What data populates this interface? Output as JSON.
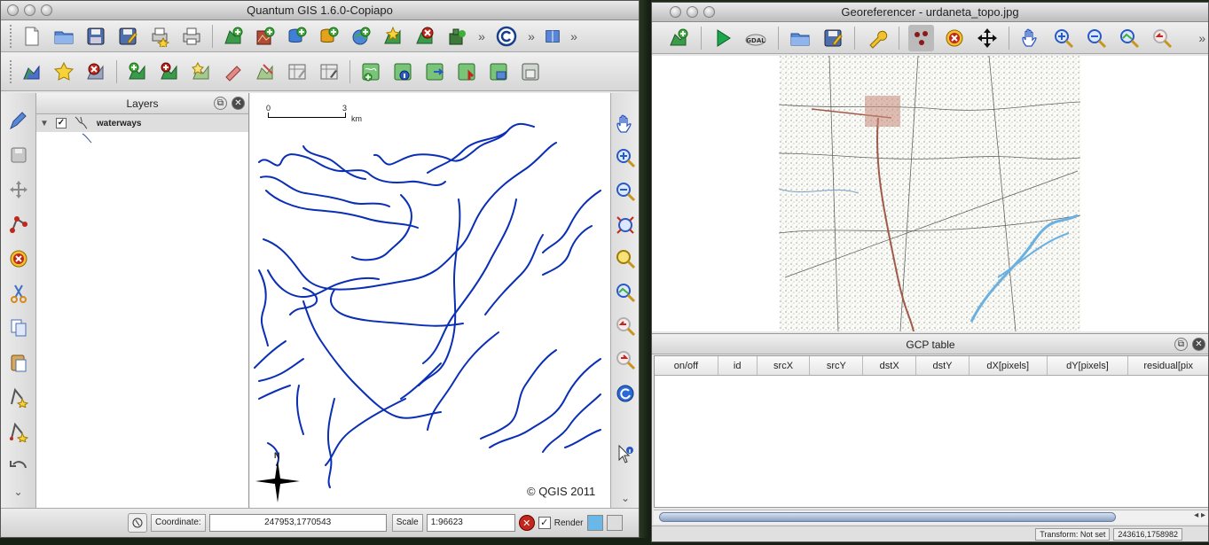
{
  "qgis": {
    "title": "Quantum GIS 1.6.0-Copiapo",
    "toolbar1_icons": [
      "new-project-icon",
      "open-project-icon",
      "save-project-icon",
      "save-as-icon",
      "print-composer-icon",
      "print-icon",
      "add-vector-layer-icon",
      "add-raster-layer-icon",
      "add-postgis-layer-icon",
      "add-spatialite-layer-icon",
      "add-wms-layer-icon",
      "new-vector-layer-icon",
      "remove-layer-icon",
      "plugin-icon",
      "copyright-icon",
      "help-icon"
    ],
    "toolbar2_icons": [
      "toggle-editing-icon",
      "capture-point-icon",
      "delete-selected-icon",
      "add-to-overview-icon",
      "show-all-layers-icon",
      "hide-all-layers-icon",
      "mapcomposer-icon",
      "vertex-tool-icon",
      "open-table-icon",
      "identify-icon",
      "measure-icon",
      "layer-properties-icon",
      "new-bookmark-icon",
      "show-bookmarks-icon",
      "map-tips-icon"
    ],
    "layers_panel": {
      "title": "Layers",
      "layers": [
        {
          "name": "waterways",
          "checked": true
        }
      ]
    },
    "map": {
      "scalebar_start": "0",
      "scalebar_end": "3",
      "scalebar_unit": "km",
      "north_label": "N",
      "copyright": "© QGIS 2011",
      "line_color": "#0a2fb5"
    },
    "status": {
      "coordinate_label": "Coordinate:",
      "coordinate_value": "247953,1770543",
      "scale_label": "Scale",
      "scale_value": "1:96623",
      "render_label": "Render",
      "render_checked": true
    }
  },
  "georef": {
    "title": "Georeferencer - urdaneta_topo.jpg",
    "gcp_title": "GCP table",
    "columns": [
      "on/off",
      "id",
      "srcX",
      "srcY",
      "dstX",
      "dstY",
      "dX[pixels]",
      "dY[pixels]",
      "residual[pix"
    ],
    "status_transform": "Transform: Not set",
    "status_coords": "243616,1758982"
  }
}
